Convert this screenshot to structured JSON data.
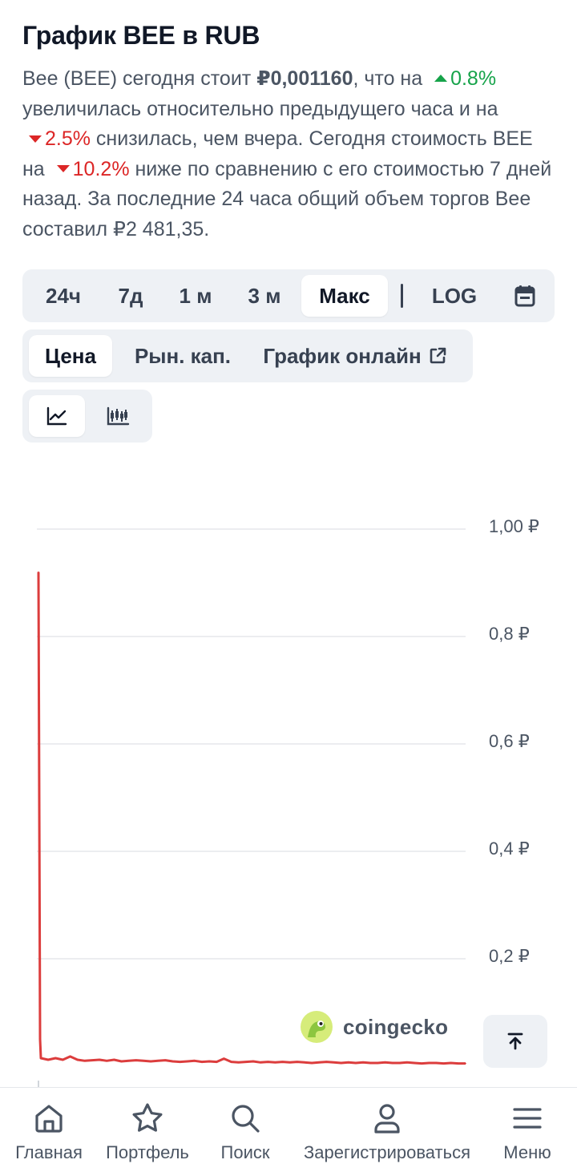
{
  "header": {
    "title": "График BEE в RUB"
  },
  "summary": {
    "part1": "Bee (BEE) сегодня стоит ",
    "price": "₽0,001160",
    "part2": ", что на ",
    "hour_change": "0.8%",
    "part3": " увеличилась относительно предыдущего часа и на ",
    "day_change": "2.5%",
    "part4": " снизилась, чем вчера. Сегодня стоимость BEE на ",
    "week_change": "10.2%",
    "part5": " ниже по сравнению с его стоимостью 7 дней назад. За последние 24 часа общий объем торгов Bee составил ₽2 481,35."
  },
  "range_tabs": {
    "items": [
      "24ч",
      "7д",
      "1 м",
      "3 м",
      "Макс"
    ],
    "active": "Макс",
    "log_label": "LOG",
    "calendar_icon": "calendar-icon"
  },
  "metric_tabs": {
    "price": "Цена",
    "market_cap": "Рын. кап.",
    "live_chart": "График онлайн",
    "active": "Цена"
  },
  "chart_type_tabs": {
    "line_icon": "line-chart-icon",
    "candle_icon": "candlestick-icon",
    "active": "line"
  },
  "chart_data": {
    "type": "line",
    "title": "",
    "xlabel": "",
    "ylabel": "",
    "ylim": [
      0,
      1.0
    ],
    "y_ticks": [
      {
        "value": 1.0,
        "label": "1,00 ₽"
      },
      {
        "value": 0.8,
        "label": "0,8 ₽"
      },
      {
        "value": 0.6,
        "label": "0,6 ₽"
      },
      {
        "value": 0.4,
        "label": "0,4 ₽"
      },
      {
        "value": 0.2,
        "label": "0,2 ₽"
      }
    ],
    "grid": true,
    "line_color": "#dc3d3d",
    "series": [
      {
        "values": [
          0.92,
          0.05,
          0.015,
          0.012,
          0.015,
          0.012,
          0.018,
          0.012,
          0.01,
          0.011,
          0.012,
          0.01,
          0.012,
          0.009,
          0.01,
          0.011,
          0.01,
          0.009,
          0.01,
          0.011,
          0.009,
          0.008,
          0.009,
          0.01,
          0.008,
          0.009,
          0.008,
          0.014,
          0.008,
          0.007,
          0.008,
          0.009,
          0.007,
          0.008,
          0.007,
          0.008,
          0.007,
          0.008,
          0.007,
          0.006,
          0.007,
          0.008,
          0.007,
          0.006,
          0.007,
          0.006,
          0.007,
          0.006,
          0.006,
          0.007,
          0.006,
          0.006,
          0.007,
          0.006,
          0.005,
          0.006,
          0.006,
          0.005,
          0.006,
          0.005,
          0.005
        ]
      }
    ],
    "watermark": "coingecko"
  },
  "scroll_top": {
    "icon": "arrow-up-to-top-icon"
  },
  "bottom_nav": {
    "items": [
      {
        "label": "Главная",
        "icon": "home-icon"
      },
      {
        "label": "Портфель",
        "icon": "star-icon"
      },
      {
        "label": "Поиск",
        "icon": "search-icon"
      },
      {
        "label": "Зарегистрироваться",
        "icon": "user-icon"
      },
      {
        "label": "Меню",
        "icon": "menu-icon"
      }
    ]
  },
  "colors": {
    "up": "#16a34a",
    "down": "#dc2626",
    "line": "#dc3d3d",
    "tab_bg": "#eef1f5"
  }
}
